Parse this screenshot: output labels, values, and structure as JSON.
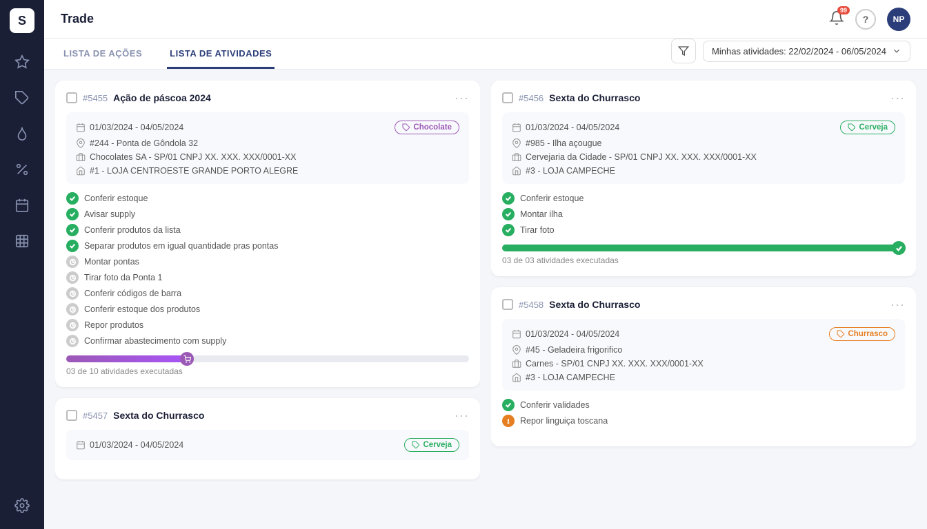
{
  "app": {
    "title": "Trade"
  },
  "header": {
    "notifications_count": "99",
    "avatar_label": "NP"
  },
  "tabs": {
    "left_label": "LISTA DE AÇÕES",
    "right_label": "LISTA DE ATIVIDADES"
  },
  "filter": {
    "label": "Minhas atividades: 22/02/2024 - 06/05/2024"
  },
  "cards": [
    {
      "id": "#5455",
      "name": "Ação de páscoa 2024",
      "date_range": "01/03/2024 - 04/05/2024",
      "tag_label": "Chocolate",
      "location": "#244 - Ponta de Gôndola 32",
      "supplier": "Chocolates SA - SP/01 CNPJ XX. XXX. XXX/0001-XX",
      "store": "#1 - LOJA CENTROESTE GRANDE PORTO ALEGRE",
      "tasks": [
        {
          "label": "Conferir estoque",
          "status": "done"
        },
        {
          "label": "Avisar supply",
          "status": "done"
        },
        {
          "label": "Conferir produtos da lista",
          "status": "done"
        },
        {
          "label": "Separar produtos em igual quantidade pras pontas",
          "status": "done"
        },
        {
          "label": "Montar pontas",
          "status": "pending"
        },
        {
          "label": "Tirar foto da Ponta 1",
          "status": "pending"
        },
        {
          "label": "Conferir códigos de barra",
          "status": "pending"
        },
        {
          "label": "Conferir estoque dos produtos",
          "status": "pending"
        },
        {
          "label": "Repor produtos",
          "status": "pending"
        },
        {
          "label": "Confirmar abastecimento com supply",
          "status": "pending"
        }
      ],
      "progress_text": "03 de 10 atividades executadas",
      "progress_pct": 30,
      "progress_type": "purple"
    },
    {
      "id": "#5457",
      "name": "Sexta do Churrasco",
      "date_range": "01/03/2024 - 04/05/2024",
      "tag_label": "Cerveja",
      "tag_type": "green",
      "location": "",
      "supplier": "",
      "store": "",
      "tasks": [],
      "progress_text": "",
      "progress_pct": 0,
      "progress_type": "purple"
    }
  ],
  "right_cards": [
    {
      "id": "#5456",
      "name": "Sexta do Churrasco",
      "date_range": "01/03/2024 - 04/05/2024",
      "tag_label": "Cerveja",
      "tag_type": "green",
      "location": "#985 - Ilha açougue",
      "supplier": "Cervejaria da Cidade - SP/01 CNPJ XX. XXX. XXX/0001-XX",
      "store": "#3 - LOJA CAMPECHE",
      "tasks": [
        {
          "label": "Conferir estoque",
          "status": "done"
        },
        {
          "label": "Montar ilha",
          "status": "done"
        },
        {
          "label": "Tirar foto",
          "status": "done"
        }
      ],
      "progress_text": "03 de 03 atividades executadas",
      "progress_pct": 100,
      "progress_type": "green"
    },
    {
      "id": "#5458",
      "name": "Sexta do Churrasco",
      "date_range": "01/03/2024 - 04/05/2024",
      "tag_label": "Churrasco",
      "tag_type": "orange",
      "location": "#45 - Geladeira frigorifico",
      "supplier": "Carnes - SP/01 CNPJ XX. XXX. XXX/0001-XX",
      "store": "#3 - LOJA CAMPECHE",
      "tasks": [
        {
          "label": "Conferir validades",
          "status": "done"
        },
        {
          "label": "Repor linguiça toscana",
          "status": "warning"
        }
      ],
      "progress_text": "",
      "progress_pct": 0,
      "progress_type": "purple"
    }
  ],
  "sidebar": {
    "items": [
      {
        "name": "star-icon"
      },
      {
        "name": "tag-icon"
      },
      {
        "name": "fire-icon"
      },
      {
        "name": "percent-icon"
      },
      {
        "name": "calendar-icon"
      },
      {
        "name": "table-icon"
      },
      {
        "name": "settings-icon"
      }
    ]
  }
}
